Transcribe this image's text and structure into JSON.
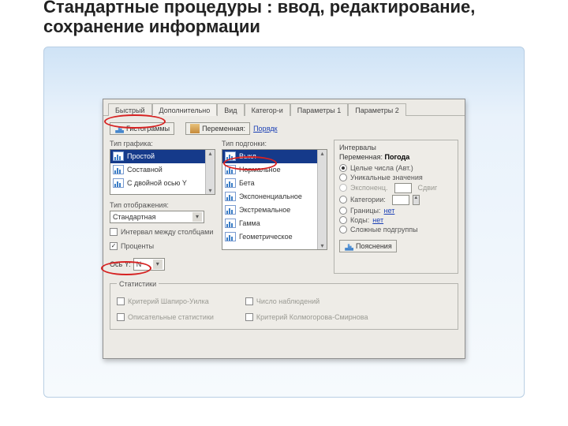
{
  "title": "Стандартные процедуры : ввод, редактирование, сохранение информации",
  "tabs": [
    "Быстрый",
    "Дополнительно",
    "Вид",
    "Категор-и",
    "Параметры 1",
    "Параметры 2"
  ],
  "active_tab": 1,
  "toprow": {
    "btn_histograms": "Гистограммы",
    "variable_lbl": "Переменная:",
    "variable_link": "Порядк"
  },
  "chart_type": {
    "label": "Тип графика:",
    "items": [
      "Простой",
      "Составной",
      "С двойной осью Y"
    ]
  },
  "fit_type": {
    "label": "Тип подгонки:",
    "items": [
      "Выкл",
      "Нормальное",
      "Бета",
      "Экспоненциальное",
      "Экстремальное",
      "Гамма",
      "Геометрическое"
    ]
  },
  "display_type": {
    "label": "Тип отображения:",
    "value": "Стандартная"
  },
  "chk_gap": "Интервал между столбцами",
  "chk_percents": "Проценты",
  "axis_y": {
    "label": "Ось Y:",
    "value": "N"
  },
  "intervals": {
    "title": "Интервалы",
    "var_label": "Переменная:",
    "var_value": "Погода",
    "r_int_auto": "Целые числа (Авт.)",
    "r_uniq": "Уникальные значения",
    "r_bounds": "Экспоненц.",
    "r_bounds_step": "Сдвиг",
    "r_cats": "Категории:",
    "r_borders": "Границы:",
    "borders_link": "нет",
    "r_codes": "Коды:",
    "codes_link": "нет",
    "r_complex": "Сложные подгруппы",
    "btn_label": "Пояснения"
  },
  "stats": {
    "legend": "Статистики",
    "c1": "Критерий Шапиро-Уилка",
    "c2": "Описательные статистики",
    "c3": "Число наблюдений",
    "c4": "Критерий Колмогорова-Смирнова"
  }
}
